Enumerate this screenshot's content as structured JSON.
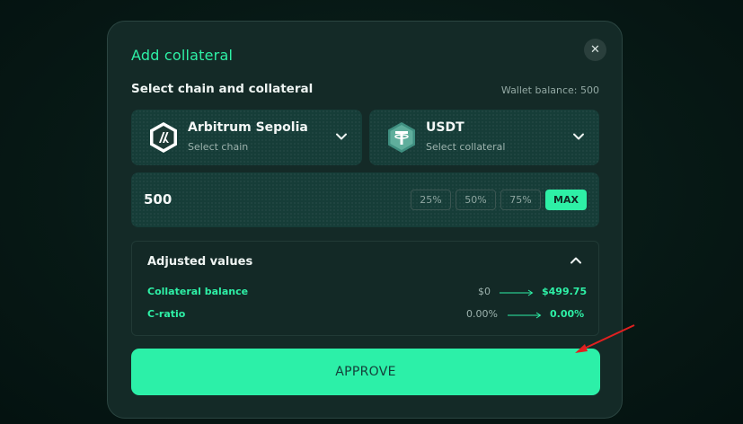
{
  "modal": {
    "title": "Add collateral",
    "close_icon": "close-icon",
    "section_title": "Select chain and collateral",
    "wallet_balance": "Wallet balance: 500"
  },
  "chain_select": {
    "icon": "arbitrum-logo-icon",
    "value": "Arbitrum Sepolia",
    "helper": "Select chain"
  },
  "collateral_select": {
    "icon": "tether-logo-icon",
    "value": "USDT",
    "helper": "Select collateral"
  },
  "amount": {
    "value": "500",
    "presets": [
      "25%",
      "50%",
      "75%"
    ],
    "max_label": "MAX"
  },
  "adjusted_values": {
    "title": "Adjusted values",
    "rows": [
      {
        "label": "Collateral balance",
        "old": "$0",
        "new": "$499.75"
      },
      {
        "label": "C-ratio",
        "old": "0.00%",
        "new": "0.00%"
      }
    ]
  },
  "approve_label": "APPROVE",
  "colors": {
    "accent": "#2ef0a6",
    "modal_bg": "#142a27",
    "card_bg": "#163d38",
    "annotation": "#e02020"
  }
}
